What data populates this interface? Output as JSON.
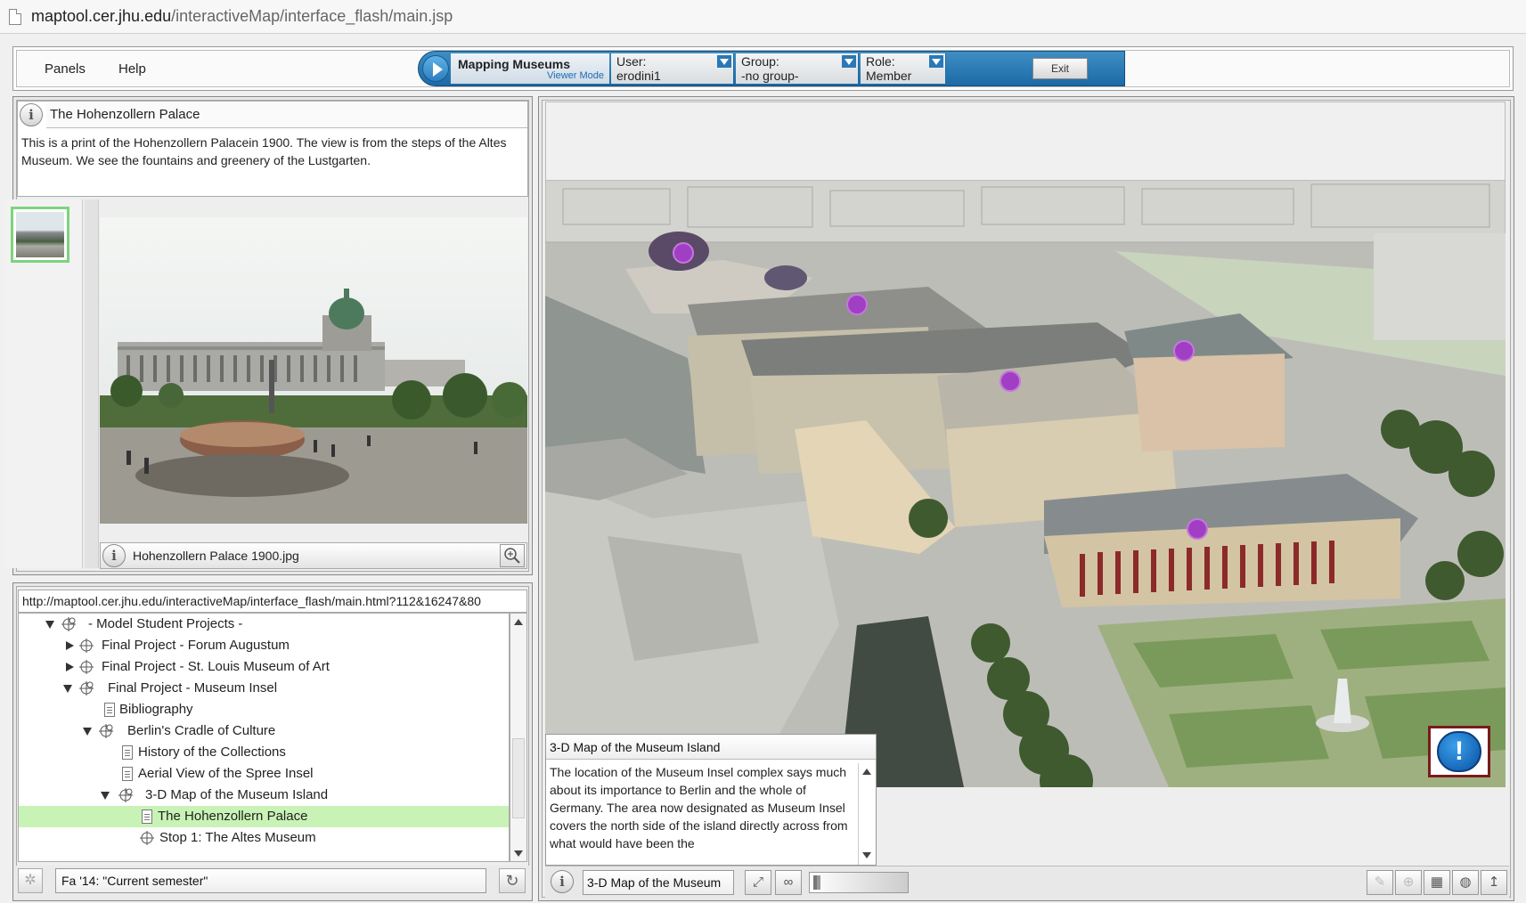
{
  "browser": {
    "url_host": "maptool.cer.jhu.edu",
    "url_path": "/interactiveMap/interface_flash/main.jsp"
  },
  "menubar": {
    "panels": "Panels",
    "help": "Help"
  },
  "app": {
    "title": "Mapping Museums",
    "mode": "Viewer Mode",
    "user_label": "User:",
    "user_value": "erodini1",
    "group_label": "Group:",
    "group_value": "-no group-",
    "role_label": "Role:",
    "role_value": "Member",
    "exit_label": "Exit"
  },
  "item_panel": {
    "title": "The Hohenzollern Palace",
    "description": "This is a print of the Hohenzollern Palacein 1900. The view is from the steps of the Altes Museum. We see the fountains and greenery of the Lustgarten.",
    "image_caption": "Hohenzollern Palace 1900.jpg"
  },
  "nav_panel": {
    "url": "http://maptool.cer.jhu.edu/interactiveMap/interface_flash/main.html?112&16247&80",
    "tree": [
      {
        "label": "- Model Student Projects -",
        "type": "folder",
        "state": "open",
        "indent": 0
      },
      {
        "label": "Final Project - Forum Augustum",
        "type": "folder",
        "state": "closed",
        "indent": 1
      },
      {
        "label": "Final Project - St. Louis Museum of Art",
        "type": "folder",
        "state": "closed",
        "indent": 1
      },
      {
        "label": "Final Project - Museum Insel",
        "type": "folder",
        "state": "open",
        "indent": 1
      },
      {
        "label": "Bibliography",
        "type": "page",
        "state": "none",
        "indent": 2
      },
      {
        "label": "Berlin's Cradle of Culture",
        "type": "folder",
        "state": "open",
        "indent": 2
      },
      {
        "label": "History of the Collections",
        "type": "page",
        "state": "none",
        "indent": 3
      },
      {
        "label": "Aerial View of the Spree Insel",
        "type": "page",
        "state": "none",
        "indent": 3
      },
      {
        "label": "3-D Map of the Museum Island",
        "type": "folder",
        "state": "open",
        "indent": 3
      },
      {
        "label": "The Hohenzollern Palace",
        "type": "page",
        "state": "selected",
        "indent": 4
      },
      {
        "label": "Stop 1: The Altes Museum",
        "type": "node",
        "state": "none",
        "indent": 4
      }
    ],
    "semester": "Fa '14: \"Current semester\""
  },
  "map_panel": {
    "card_title": "3-D Map of the Museum Island",
    "card_body": "The location of the Museum Insel complex says much about its importance to Berlin and the whole of Germany. The area now designated as Museum Insel covers the north side of the island directly across from what would have been the",
    "bottom_label": "3-D Map of the Museum",
    "alert_glyph": "!"
  },
  "colors": {
    "accent_blue": "#1d6aa6",
    "selection_green": "#c9f3b6",
    "marker_purple": "#a13fc4"
  },
  "icons": {
    "info": "info-icon",
    "zoom": "zoom-in-icon",
    "refresh": "refresh-icon",
    "alert": "alert-icon"
  }
}
